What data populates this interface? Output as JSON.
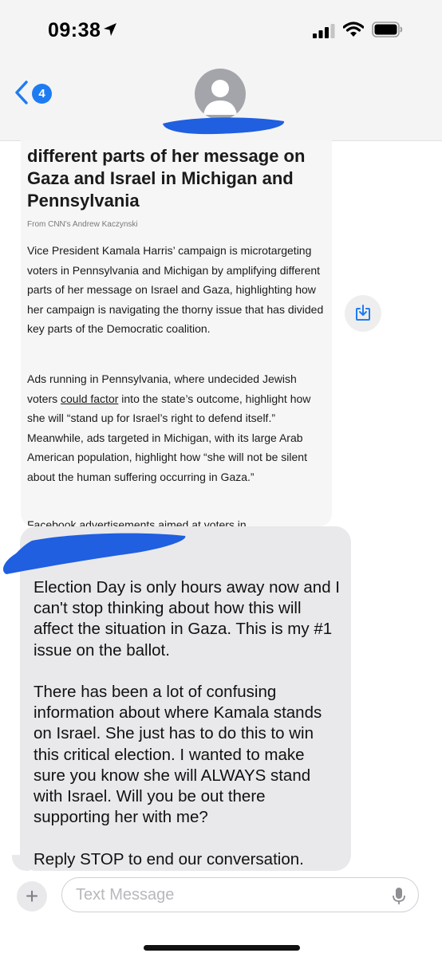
{
  "status_bar": {
    "time": "09:38"
  },
  "nav": {
    "back_badge": "4"
  },
  "article": {
    "headline": "different parts of her message on Gaza and Israel in Michigan and Pennsylvania",
    "byline": "From CNN's Andrew Kaczynski",
    "para1": "Vice President Kamala Harris’ campaign is microtargeting voters in Pennsylvania and Michigan by amplifying different parts of her message on Israel and Gaza, highlighting how her campaign is navigating the thorny issue that has divided key parts of the Democratic coalition.",
    "para2_before": "Ads running in Pennsylvania, where undecided Jewish voters ",
    "para2_link": "could factor",
    "para2_after": " into the state’s outcome, highlight how she will “stand up for Israel’s right to defend itself.” Meanwhile, ads targeted in Michigan, with its large Arab American population, highlight how “she will not be silent about the human suffering occurring in Gaza.”",
    "para3_partial": "Facebook advertisements aimed at voters in"
  },
  "message": {
    "text": "Election Day is only hours away now and I can't stop thinking about how this will affect the situation in Gaza. This is my #1 issue on the ballot.\n\nThere has been a lot of confusing information about where Kamala stands on Israel. She just has to do this to win this critical election. I wanted to make sure you know she will ALWAYS stand with Israel. Will you be out there supporting her with me?\n\nReply STOP to end our conversation."
  },
  "compose": {
    "plus": "+",
    "placeholder": "Text Message"
  },
  "colors": {
    "accent": "#1e7cf2",
    "redaction": "#1f5fe0",
    "bubble": "#e9e9eb"
  },
  "icons": [
    "location-arrow-icon",
    "cellular-signal-icon",
    "wifi-icon",
    "battery-icon",
    "chevron-left-icon",
    "person-icon",
    "save-download-icon",
    "plus-icon",
    "microphone-icon"
  ]
}
